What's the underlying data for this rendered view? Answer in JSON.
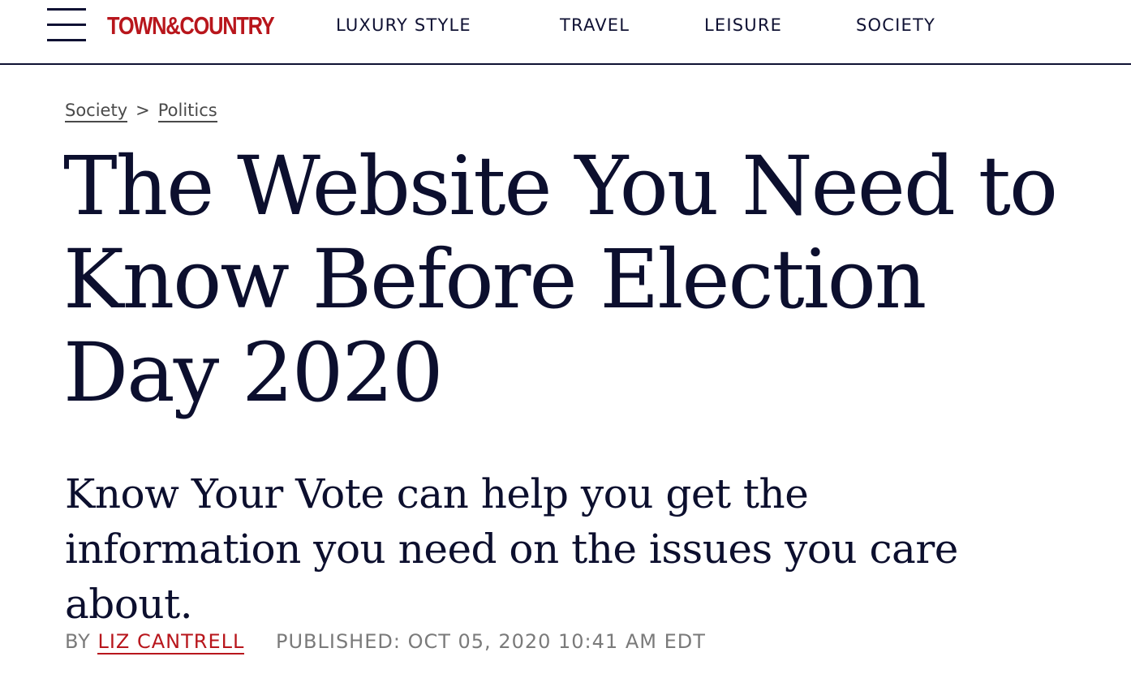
{
  "header": {
    "logo_text": "TOWN&COUNTRY",
    "menu_icon": "hamburger-menu-icon",
    "nav": [
      "LUXURY STYLE",
      "TRAVEL",
      "LEISURE",
      "SOCIETY"
    ]
  },
  "breadcrumb": {
    "items": [
      "Society",
      "Politics"
    ],
    "separator": ">"
  },
  "article": {
    "title": "The Website You Need to Know Before Election Day 2020",
    "dek": "Know Your Vote can help you get the information you need on the issues you care about.",
    "byline_prefix": "BY",
    "author": "LIZ CANTRELL",
    "published": "PUBLISHED: OCT 05, 2020 10:41 AM EDT"
  },
  "colors": {
    "brand": "#b8161c",
    "text": "#0c0f2e",
    "muted": "#7a7a7a"
  }
}
